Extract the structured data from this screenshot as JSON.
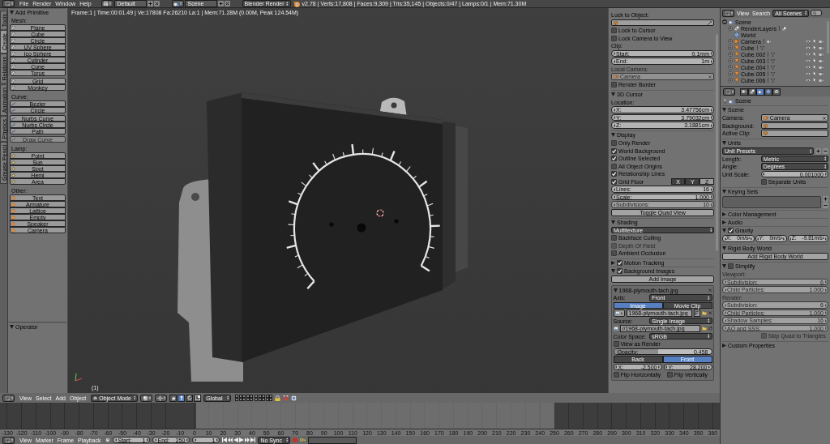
{
  "info_bar": {
    "menus": [
      "File",
      "Render",
      "Window",
      "Help"
    ],
    "layout": "Default",
    "scene": "Scene",
    "engine": "Blender Render",
    "stats": "v2.78 | Verts:17,808 | Faces:9,309 | Tris:35,145 | Objects:0/47 | Lamps:0/1 | Mem:71.30M"
  },
  "tool_shelf": {
    "tabs": [
      {
        "label": "Tools",
        "selected": false
      },
      {
        "label": "Create",
        "selected": true
      },
      {
        "label": "Relations",
        "selected": false
      },
      {
        "label": "Animation",
        "selected": false
      },
      {
        "label": "Physics",
        "selected": false
      },
      {
        "label": "Grease Pencil",
        "selected": false
      }
    ],
    "panel": {
      "title": "Add Primitive",
      "expanded": true,
      "groups": [
        {
          "label": "Mesh:",
          "kind": "mesh",
          "blocks": [
            {
              "disabled": false,
              "buttons": [
                "Plane",
                "Cube",
                "Circle",
                "UV Sphere",
                "Ico Sphere",
                "Cylinder",
                "Cone",
                "Torus"
              ]
            },
            {
              "disabled": false,
              "buttons": [
                "Grid",
                "Monkey"
              ]
            }
          ]
        },
        {
          "label": "Curve:",
          "kind": "curve",
          "blocks": [
            {
              "disabled": false,
              "buttons": [
                "Bezier",
                "Circle"
              ]
            },
            {
              "disabled": false,
              "buttons": [
                "Nurbs Curve",
                "Nurbs Circle",
                "Path"
              ]
            },
            {
              "disabled": true,
              "buttons": [
                "Draw Curve"
              ]
            }
          ]
        },
        {
          "label": "Lamp:",
          "kind": "lamp",
          "blocks": [
            {
              "disabled": false,
              "buttons": [
                "Point",
                "Sun",
                "Spot",
                "Hemi",
                "Area"
              ]
            }
          ]
        },
        {
          "label": "Other:",
          "kind": "other",
          "blocks": [
            {
              "disabled": false,
              "buttons": [
                "Text",
                "Armature",
                "Lattice",
                "Empty",
                "Speaker",
                "Camera"
              ]
            }
          ]
        }
      ]
    },
    "operator_panel": {
      "title": "Operator",
      "expanded": true
    }
  },
  "viewport": {
    "overlay": "Frame:1 | Time:00:01.49 | Ve:17808 Fa:26210 La:1 | Mem:71.28M (0.00M, Peak 124.54M)",
    "frame_label": "(1)"
  },
  "view_sidebar": {
    "panels": [
      {
        "rows": [
          {
            "kind": "label",
            "text": "Lock to Object:",
            "disabled": false
          },
          {
            "kind": "field",
            "eyedropper": true,
            "disabled": false
          },
          {
            "kind": "checkbox",
            "label": "Lock to Cursor",
            "checked": false,
            "disabled": false
          },
          {
            "kind": "checkbox",
            "label": "Lock Camera to View",
            "checked": false,
            "disabled": false
          },
          {
            "kind": "label",
            "text": "Clip:",
            "disabled": false
          },
          {
            "kind": "number",
            "label": "Start:",
            "value": "0.1mm",
            "disabled": false
          },
          {
            "kind": "number",
            "label": "End:",
            "value": "1m",
            "disabled": false
          },
          {
            "kind": "label",
            "text": "Local Camera:",
            "disabled": true
          },
          {
            "kind": "field",
            "value": "Camera",
            "disabled": true
          },
          {
            "kind": "checkbox",
            "label": "Render Border",
            "checked": false,
            "disabled": false
          }
        ]
      },
      {
        "title": "3D Cursor",
        "expanded": true,
        "rows": [
          {
            "kind": "label",
            "text": "Location:",
            "disabled": false
          },
          {
            "kind": "number",
            "label": "X:",
            "value": "3.47756cm",
            "disabled": false
          },
          {
            "kind": "number",
            "label": "Y:",
            "value": "3.79032cm",
            "disabled": false
          },
          {
            "kind": "number",
            "label": "Z:",
            "value": "3.1881cm",
            "disabled": false
          }
        ]
      },
      {
        "title": "Display",
        "expanded": true,
        "rows": [
          {
            "kind": "checkbox",
            "label": "Only Render",
            "checked": false,
            "disabled": false
          },
          {
            "kind": "checkbox",
            "label": "World Background",
            "checked": true,
            "disabled": false
          },
          {
            "kind": "checkbox",
            "label": "Outline Selected",
            "checked": true,
            "disabled": false
          },
          {
            "kind": "checkbox",
            "label": "All Object Origins",
            "checked": false,
            "disabled": false
          },
          {
            "kind": "checkbox",
            "label": "Relationship Lines",
            "checked": true,
            "disabled": false
          },
          {
            "kind": "checkbox",
            "label": "Grid Floor",
            "checked": true,
            "disabled": false,
            "axes": [
              {
                "label": "X",
                "selected": true
              },
              {
                "label": "Y",
                "selected": true
              },
              {
                "label": "Z",
                "selected": false
              }
            ]
          },
          {
            "kind": "number",
            "label": "Lines:",
            "value": "16",
            "disabled": false
          },
          {
            "kind": "number",
            "label": "Scale:",
            "value": "1.000",
            "disabled": false
          },
          {
            "kind": "number",
            "label": "Subdivisions:",
            "value": "10",
            "disabled": true
          },
          {
            "kind": "button",
            "label": "Toggle Quad View",
            "disabled": false
          }
        ]
      },
      {
        "title": "Shading",
        "expanded": true,
        "rows": [
          {
            "kind": "dropdown",
            "value": "Multitexture",
            "disabled": false
          },
          {
            "kind": "checkbox",
            "label": "Backface Culling",
            "checked": false,
            "disabled": false
          },
          {
            "kind": "checkbox",
            "label": "Depth Of Field",
            "checked": false,
            "disabled": true
          },
          {
            "kind": "checkbox",
            "label": "Ambient Occlusion",
            "checked": false,
            "disabled": false
          }
        ]
      },
      {
        "title": "Motion Tracking",
        "expanded": false,
        "checked": true
      },
      {
        "title": "Background Images",
        "expanded": true,
        "checked": true,
        "rows": [
          {
            "kind": "button",
            "label": "Add Image",
            "disabled": false
          },
          {
            "kind": "box",
            "title": "1968-plymouth-tach.jpg",
            "expanded": true,
            "disabled": false,
            "rows": [
              {
                "kind": "dropdown",
                "label": "Axis:",
                "value": "Front",
                "disabled": false
              },
              {
                "kind": "toggles",
                "disabled": false,
                "options": [
                  {
                    "label": "Image",
                    "selected": true
                  },
                  {
                    "label": "Movie Clip",
                    "selected": false
                  }
                ]
              },
              {
                "kind": "image_field",
                "value": "1968-plymouth-tach.jpg",
                "badge": "F",
                "disabled": false
              },
              {
                "kind": "dropdown",
                "label": "Source:",
                "value": "Single Image",
                "disabled": false
              },
              {
                "kind": "path_field",
                "value": "//1968-plymouth-tach.jpg",
                "disabled": false
              },
              {
                "kind": "dropdown",
                "label": "Color Space:",
                "value": "sRGB",
                "disabled": false
              },
              {
                "kind": "checkbox",
                "label": "View as Render",
                "checked": false,
                "disabled": false
              },
              {
                "kind": "slider",
                "label": "Opacity:",
                "value": "0.458",
                "level": 0.458,
                "disabled": false
              },
              {
                "kind": "toggles",
                "disabled": false,
                "options": [
                  {
                    "label": "Back",
                    "selected": false
                  },
                  {
                    "label": "Front",
                    "selected": true
                  }
                ]
              },
              {
                "kind": "inline_numbers",
                "disabled": false,
                "items": [
                  {
                    "label": "X:",
                    "value": "-2.500"
                  },
                  {
                    "label": "Y:",
                    "value": "28.200"
                  }
                ]
              },
              {
                "kind": "inline_checks",
                "disabled": false,
                "items": [
                  {
                    "label": "Flip Horizontally",
                    "checked": false
                  },
                  {
                    "label": "Flip Vertically",
                    "checked": false
                  }
                ]
              }
            ]
          }
        ]
      }
    ]
  },
  "outliner": {
    "menus": [
      "View",
      "Search"
    ],
    "filter": "All Scenes",
    "tree": [
      {
        "label": "Scene",
        "kind": "scene",
        "expanded": true,
        "children": [
          {
            "label": "RenderLayers",
            "kind": "render_layers",
            "expanded": false
          },
          {
            "label": "World",
            "kind": "world"
          },
          {
            "label": "Camera",
            "kind": "camera",
            "expanded": false
          },
          {
            "label": "Cube",
            "kind": "mesh",
            "expanded": false
          },
          {
            "label": "Cube.002",
            "kind": "mesh",
            "expanded": false
          },
          {
            "label": "Cube.003",
            "kind": "mesh",
            "expanded": false
          },
          {
            "label": "Cube.004",
            "kind": "mesh",
            "expanded": false
          },
          {
            "label": "Cube.005",
            "kind": "mesh",
            "expanded": false
          },
          {
            "label": "Cube.006",
            "kind": "mesh",
            "expanded": false
          }
        ]
      }
    ]
  },
  "properties": {
    "tabs": [
      {
        "kind": "render",
        "selected": false
      },
      {
        "kind": "render_layers",
        "selected": false
      },
      {
        "kind": "scene",
        "selected": true
      },
      {
        "kind": "world",
        "selected": false
      },
      {
        "kind": "object",
        "selected": false
      }
    ],
    "context": "Scene",
    "panels": [
      {
        "title": "Scene",
        "expanded": true,
        "rows": [
          {
            "kind": "prop_field",
            "label": "Camera:",
            "value": "Camera",
            "disabled": false
          },
          {
            "kind": "prop_field",
            "label": "Background:",
            "disabled": false
          },
          {
            "kind": "prop_field",
            "label": "Active Clip:",
            "disabled": false
          }
        ]
      },
      {
        "title": "Units",
        "expanded": true,
        "rows": [
          {
            "kind": "preset",
            "value": "Unit Presets",
            "disabled": false
          },
          {
            "kind": "prop_dropdown",
            "label": "Length:",
            "value": "Metric",
            "disabled": false
          },
          {
            "kind": "prop_dropdown",
            "label": "Angle:",
            "value": "Degrees",
            "disabled": false
          },
          {
            "kind": "prop_number",
            "label": "Unit Scale:",
            "value": "0.001000",
            "disabled": false
          },
          {
            "kind": "split_checkbox",
            "label": "Separate Units",
            "checked": false,
            "disabled": false
          }
        ]
      },
      {
        "title": "Keying Sets",
        "expanded": true,
        "rows": [
          {
            "kind": "list_box",
            "disabled": false
          }
        ]
      },
      {
        "title": "Color Management",
        "expanded": false
      },
      {
        "title": "Audio",
        "expanded": false
      },
      {
        "title": "Gravity",
        "expanded": true,
        "checked": true,
        "rows": [
          {
            "kind": "inline_numbers",
            "disabled": false,
            "items": [
              {
                "label": "X:",
                "value": "0m/s²"
              },
              {
                "label": "Y:",
                "value": "0m/s²"
              },
              {
                "label": "Z:",
                "value": "-9.81m/s²"
              }
            ]
          }
        ]
      },
      {
        "title": "Rigid Body World",
        "expanded": true,
        "rows": [
          {
            "kind": "button",
            "label": "Add Rigid Body World",
            "disabled": false
          }
        ]
      },
      {
        "title": "Simplify",
        "expanded": true,
        "checked": false,
        "rows": [
          {
            "kind": "columns",
            "disabled": true,
            "columns": [
              {
                "title": "Viewport:",
                "rows": [
                  {
                    "kind": "number",
                    "label": "Subdivision:",
                    "value": "6",
                    "disabled": true
                  },
                  {
                    "kind": "number",
                    "label": "Child Particles:",
                    "value": "1.000",
                    "disabled": true
                  }
                ]
              },
              {
                "title": "Render:",
                "rows": [
                  {
                    "kind": "number",
                    "label": "Subdivision:",
                    "value": "6",
                    "disabled": true
                  },
                  {
                    "kind": "number",
                    "label": "Child Particles:",
                    "value": "1.000",
                    "disabled": true
                  },
                  {
                    "kind": "number",
                    "label": "Shadow Samples:",
                    "value": "16",
                    "disabled": true
                  },
                  {
                    "kind": "number",
                    "label": "AO and SSS:",
                    "value": "1.000",
                    "disabled": true
                  }
                ]
              }
            ]
          },
          {
            "kind": "split_checkbox",
            "label": "Skip Quad to Triangles",
            "checked": false,
            "disabled": true
          }
        ]
      },
      {
        "title": "Custom Properties",
        "expanded": false
      }
    ]
  },
  "view3d_header": {
    "menus": [
      "View",
      "Select",
      "Add",
      "Object"
    ],
    "mode": "Object Mode",
    "manipulators": [
      {
        "kind": "toggle",
        "selected": false
      },
      {
        "kind": "translate",
        "selected": true
      },
      {
        "kind": "rotate",
        "selected": false
      },
      {
        "kind": "scale",
        "selected": false
      }
    ],
    "orientation": "Global"
  },
  "timeline": {
    "ruler": [
      "-130",
      "-120",
      "-110",
      "-100",
      "-90",
      "-80",
      "-70",
      "-60",
      "-50",
      "-40",
      "-30",
      "-20",
      "-10",
      "0",
      "10",
      "20",
      "30",
      "40",
      "50",
      "60",
      "70",
      "80",
      "90",
      "100",
      "110",
      "120",
      "130",
      "140",
      "150",
      "160",
      "170",
      "180",
      "190",
      "200",
      "210",
      "220",
      "230",
      "240",
      "250",
      "260",
      "270",
      "280",
      "290",
      "300",
      "310",
      "320",
      "330",
      "340",
      "350",
      "360"
    ]
  },
  "timeline_header": {
    "menus": [
      "View",
      "Marker",
      "Frame",
      "Playback"
    ],
    "start": {
      "label": "Start:",
      "value": "1"
    },
    "end": {
      "label": "End:",
      "value": "250"
    },
    "current": "1",
    "sync": "No Sync"
  }
}
